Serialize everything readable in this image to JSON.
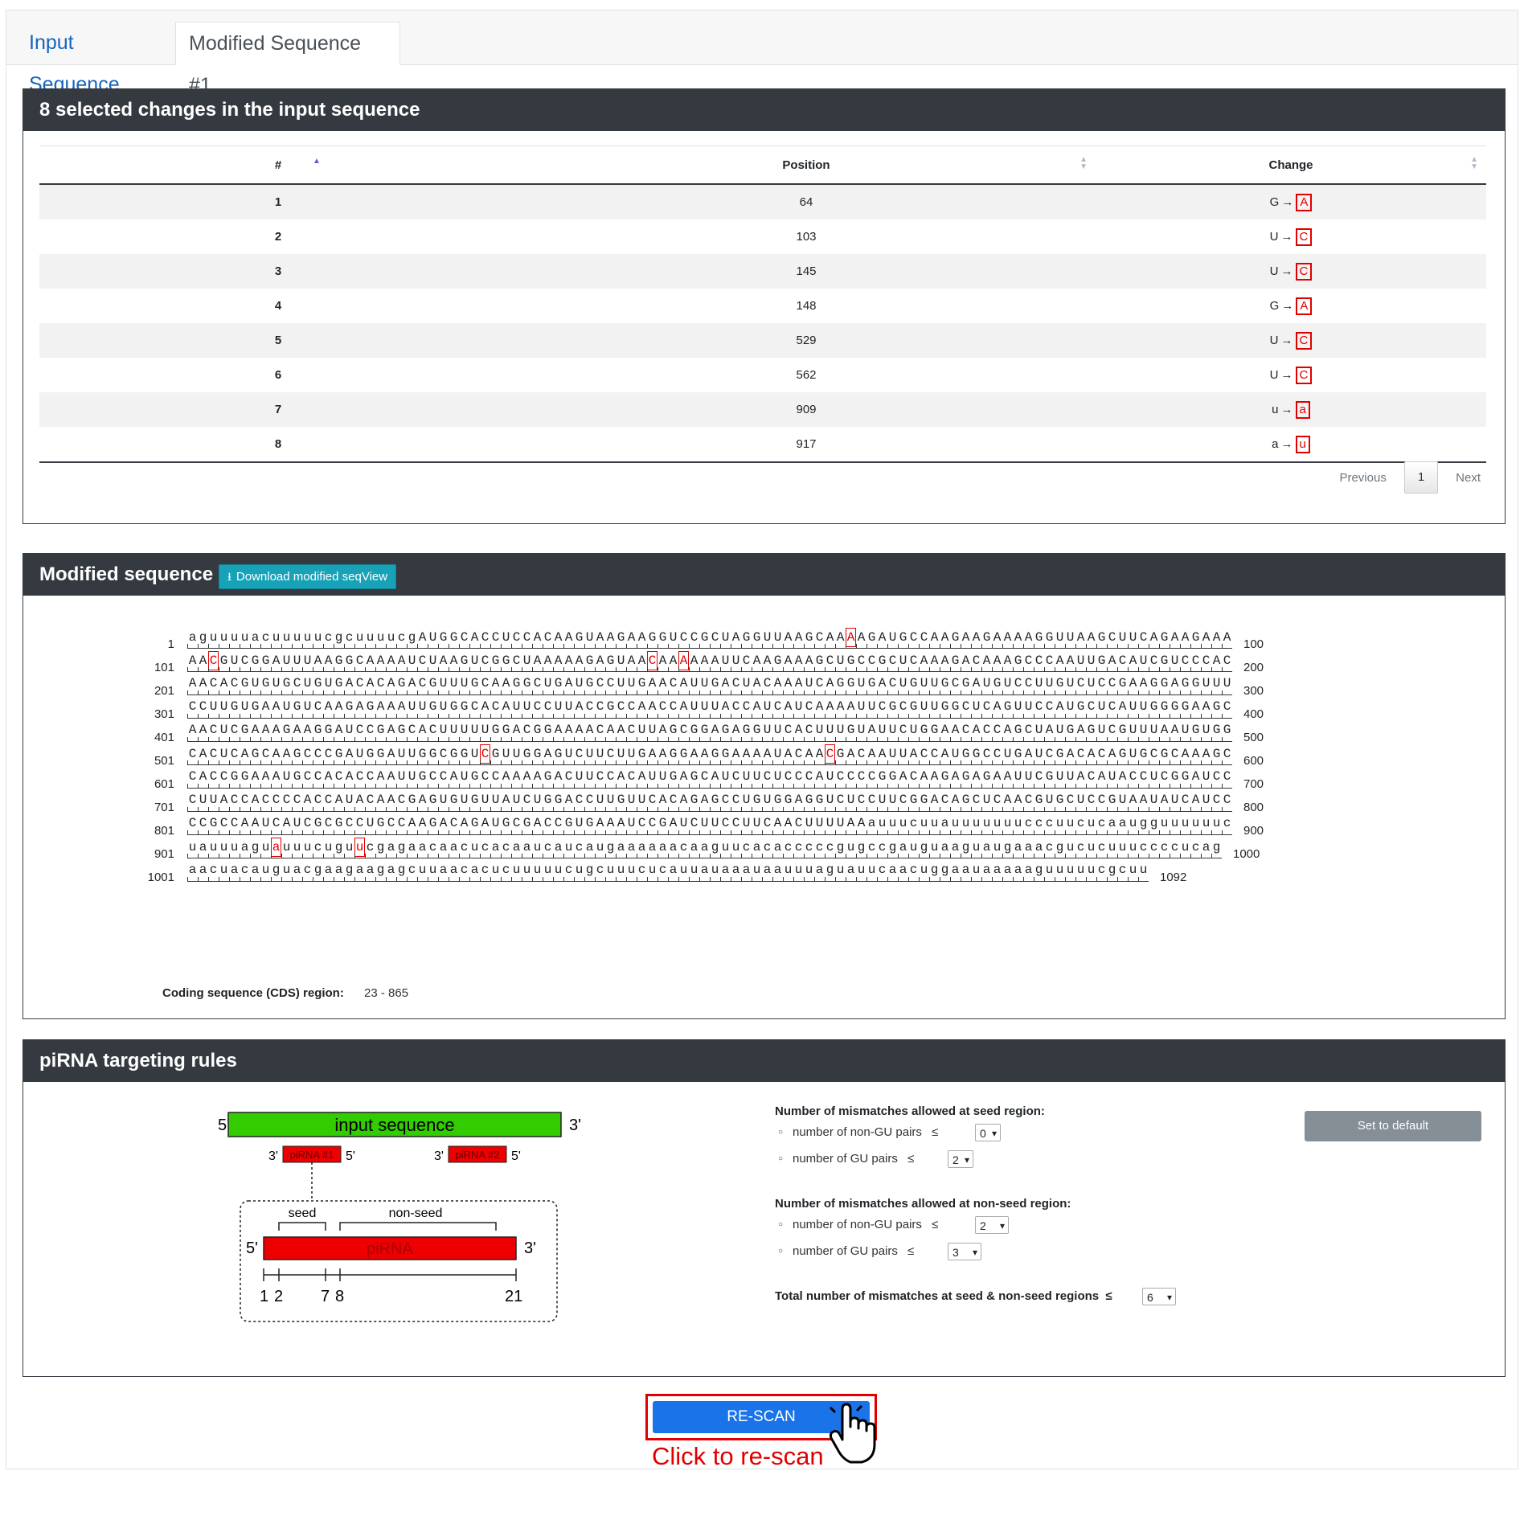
{
  "tabs": [
    {
      "label": "Input Sequence"
    },
    {
      "label": "Modified Sequence #1"
    }
  ],
  "changes_panel": {
    "title": "8 selected changes in the input sequence",
    "columns": [
      "#",
      "Position",
      "Change"
    ],
    "rows": [
      {
        "n": "1",
        "pos": "64",
        "from": "G",
        "to": "A"
      },
      {
        "n": "2",
        "pos": "103",
        "from": "U",
        "to": "C"
      },
      {
        "n": "3",
        "pos": "145",
        "from": "U",
        "to": "C"
      },
      {
        "n": "4",
        "pos": "148",
        "from": "G",
        "to": "A"
      },
      {
        "n": "5",
        "pos": "529",
        "from": "U",
        "to": "C"
      },
      {
        "n": "6",
        "pos": "562",
        "from": "U",
        "to": "C"
      },
      {
        "n": "7",
        "pos": "909",
        "from": "u",
        "to": "a"
      },
      {
        "n": "8",
        "pos": "917",
        "from": "a",
        "to": "u"
      }
    ],
    "arrow": "→",
    "pagination": {
      "previous": "Previous",
      "page": "1",
      "next": "Next"
    }
  },
  "sequence_panel": {
    "title": "Modified sequence",
    "download_label": "Download modified seqView",
    "lines": [
      {
        "start": "1",
        "end": "100",
        "seq": "aguuuuacuuuuucgcuuuucgAUGGCACCUCCACAAGUAAGAAGGUCCGCUAGGUUAAGCAAAAGAUGCCAAGAAGAAAAGGUUAAGCUUCAGAAGAAA",
        "marks": [
          63
        ]
      },
      {
        "start": "101",
        "end": "200",
        "seq": "AACGUCGGAUUUAAGGCAAAAUCUAAGUCGGCUAAAAAGAGUAACAAAAAAUUCAAGAAAGCUGCCGCUCAAAGACAAAGCCCAAUUGACAUCGUCCCAC",
        "marks": [
          2,
          44,
          47
        ]
      },
      {
        "start": "201",
        "end": "300",
        "seq": "AACACGUGUGCUGUGACACAGACGUUUGCAAGGCUGAUGCCUUGAACAUUGACUACAAAUCAGGUGACUGUUGCGAUGUCCUUGUCUCCGAAGGAGGUUU",
        "marks": []
      },
      {
        "start": "301",
        "end": "400",
        "seq": "CCUUGUGAAUGUCAAGAGAAAUUGUGGCACAUUCCUUACCGCCAACCAUUUACCAUCAUCAAAAUUCGCGUUGGCUCAGUUCCAUGCUCAUUGGGGAAGC",
        "marks": []
      },
      {
        "start": "401",
        "end": "500",
        "seq": "AACUCGAAAGAAGGAUCCGAGCACUUUUUGGACGGAAAACAACUUAGCGGAGAGGUUCACUUUGUAUUCUGGAACACCAGCUAUGAGUCGUUUAAUGUGG",
        "marks": []
      },
      {
        "start": "501",
        "end": "600",
        "seq": "CACUCAGCAAGCCCGAUGGAUUGGCGGUCGUUGGAGUCUUCUUGAAGGAAGGAAAAUACAACGACAAUUACCAUGGCCUGAUCGACACAGUGCGCAAAGC",
        "marks": [
          28,
          61
        ]
      },
      {
        "start": "601",
        "end": "700",
        "seq": "CACCGGAAAUGCCACACCAAUUGCCAUGCCAAAAGACUUCCACAUUGAGCAUCUUCUCCCAUCCCCGGACAAGAGAGAAUUCGUUACAUACCUCGGAUCC",
        "marks": []
      },
      {
        "start": "701",
        "end": "800",
        "seq": "CUUACCACCCCACCAUACAACGAGUGUGUUAUCUGGACCUUGUUCACAGAGCCUGUGGAGGUCUCCUUCGGACAGCUCAACGUGCUCCGUAAUAUCAUCC",
        "marks": []
      },
      {
        "start": "801",
        "end": "900",
        "seq": "CCGCCAAUCAUCGCGCCUGCCAAGACAGAUGCGACCGUGAAAUCCGAUCUUCCUUCAACUUUUAAauuucuuauuuuuuucccuucucaaugguuuuuuc",
        "marks": []
      },
      {
        "start": "901",
        "end": "1000",
        "seq": "uauuuagua uuucugu ucgagaacaacucacaaucaucaugaaaaaacaaguucacacccccgugccgauguaaguaugaaacgucucuuuccccucag",
        "marks": [
          8,
          16
        ]
      },
      {
        "start": "1001",
        "end": "1092",
        "seq": "aacuacauguacgaagaagagcuuaacacucuuuuucugcuuucucauuauaaauaauuuaguauucaacuggaauaaaaaguuuuucgcuu",
        "marks": []
      }
    ],
    "cds_label": "Coding sequence (CDS) region:",
    "cds_value": "23 - 865"
  },
  "rules_panel": {
    "title": "piRNA targeting rules",
    "diagram": {
      "five_prime": "5'",
      "three_prime": "3'",
      "input_label": "input sequence",
      "pirna1": "piRNA #1",
      "pirna2": "piRNA #2",
      "seed": "seed",
      "nonseed": "non-seed",
      "pirna": "piRNA",
      "t1": "1",
      "t2": "2",
      "t7": "7",
      "t8": "8",
      "t21": "21"
    },
    "seed_heading": "Number of mismatches allowed at seed region:",
    "seed_nongu_label": "number of non-GU pairs",
    "seed_nongu_value": "0",
    "seed_gu_label": "number of GU pairs",
    "seed_gu_value": "2",
    "nonseed_heading": "Number of mismatches allowed at non-seed region:",
    "nonseed_nongu_label": "number of non-GU pairs",
    "nonseed_nongu_value": "2",
    "nonseed_gu_label": "number of GU pairs",
    "nonseed_gu_value": "3",
    "total_label": "Total number of mismatches at seed & non-seed regions",
    "total_value": "6",
    "le": "≤",
    "default_label": "Set to default"
  },
  "rescan": {
    "label": "RE-SCAN",
    "caption": "Click to re-scan"
  },
  "colors": {
    "header_bg": "#343a40",
    "mutation": "#e00000",
    "input_bar": "#33cc00",
    "pirna_bar": "#ee0000",
    "rescan_btn": "#1a73e8",
    "download_btn": "#17a2b8"
  },
  "icons": {
    "download": "download-icon",
    "pointer": "hand-pointer-icon"
  }
}
